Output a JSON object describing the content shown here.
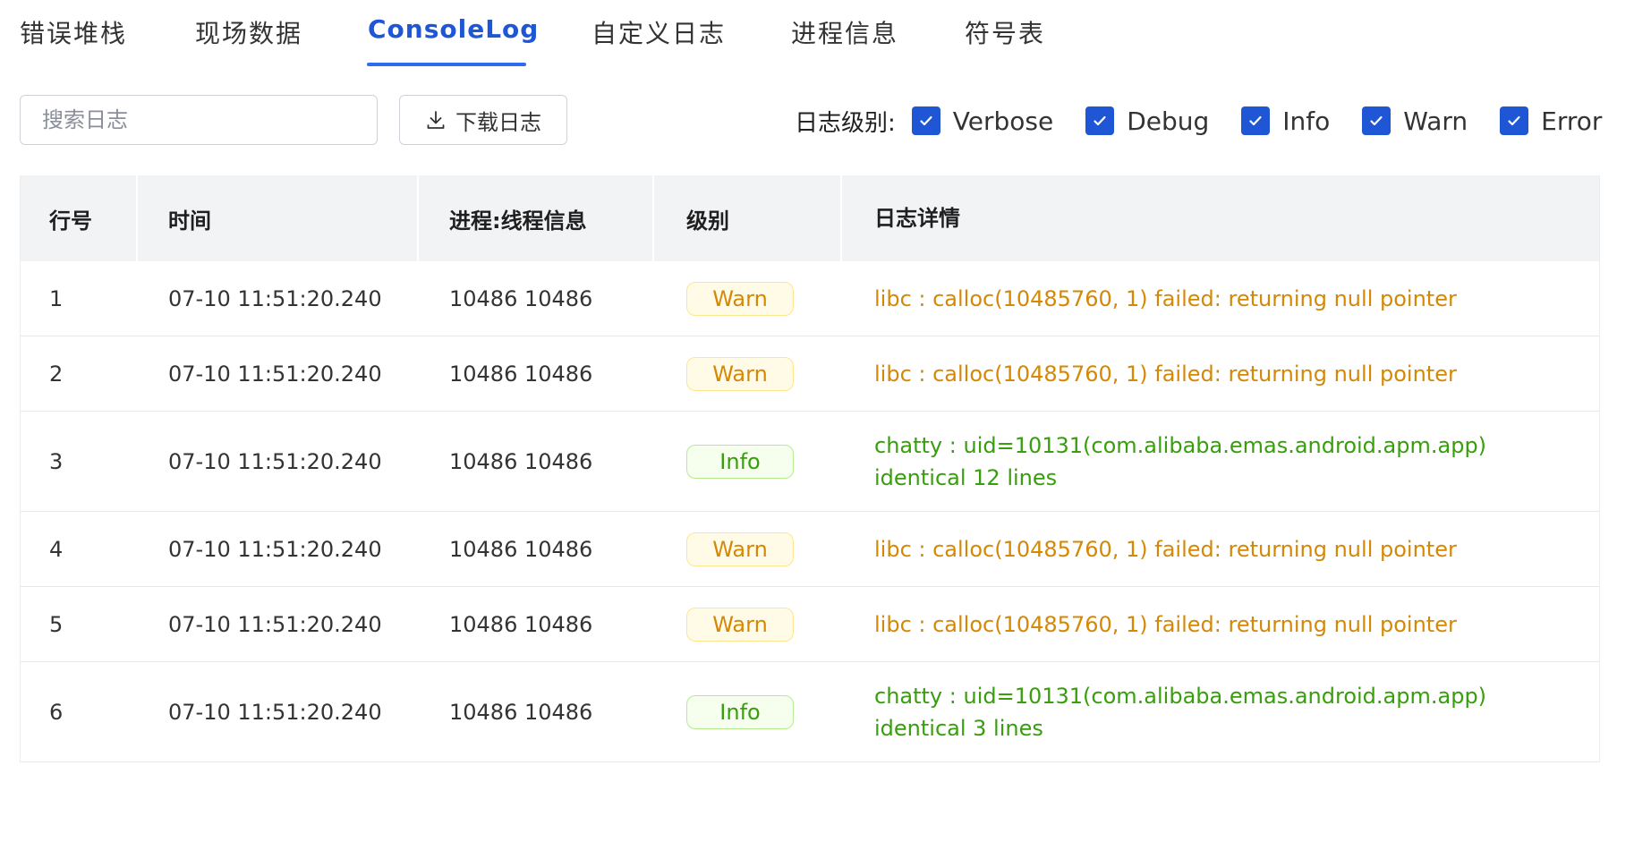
{
  "tabs": [
    {
      "label": "错误堆栈",
      "active": false
    },
    {
      "label": "现场数据",
      "active": false
    },
    {
      "label": "ConsoleLog",
      "active": true
    },
    {
      "label": "自定义日志",
      "active": false
    },
    {
      "label": "进程信息",
      "active": false
    },
    {
      "label": "符号表",
      "active": false
    }
  ],
  "toolbar": {
    "search_placeholder": "搜索日志",
    "download_label": "下载日志",
    "download_icon": "download-icon",
    "levels_label": "日志级别:",
    "levels": [
      {
        "label": "Verbose",
        "checked": true
      },
      {
        "label": "Debug",
        "checked": true
      },
      {
        "label": "Info",
        "checked": true
      },
      {
        "label": "Warn",
        "checked": true
      },
      {
        "label": "Error",
        "checked": true
      }
    ]
  },
  "table": {
    "headers": [
      "行号",
      "时间",
      "进程:线程信息",
      "级别",
      "日志详情"
    ],
    "rows": [
      {
        "line": "1",
        "time": "07-10 11:51:20.240",
        "pid": "10486 10486",
        "level": "Warn",
        "detail": "libc : calloc(10485760, 1) failed: returning null pointer"
      },
      {
        "line": "2",
        "time": "07-10 11:51:20.240",
        "pid": "10486 10486",
        "level": "Warn",
        "detail": "libc : calloc(10485760, 1) failed: returning null pointer"
      },
      {
        "line": "3",
        "time": "07-10 11:51:20.240",
        "pid": "10486 10486",
        "level": "Info",
        "detail": "chatty : uid=10131(com.alibaba.emas.android.apm.app) identical 12 lines"
      },
      {
        "line": "4",
        "time": "07-10 11:51:20.240",
        "pid": "10486 10486",
        "level": "Warn",
        "detail": "libc : calloc(10485760, 1) failed: returning null pointer"
      },
      {
        "line": "5",
        "time": "07-10 11:51:20.240",
        "pid": "10486 10486",
        "level": "Warn",
        "detail": "libc : calloc(10485760, 1) failed: returning null pointer"
      },
      {
        "line": "6",
        "time": "07-10 11:51:20.240",
        "pid": "10486 10486",
        "level": "Info",
        "detail": "chatty : uid=10131(com.alibaba.emas.android.apm.app) identical 3 lines"
      }
    ]
  },
  "colors": {
    "accent": "#1e56d6",
    "warn": "#d48806",
    "info": "#389e0d"
  }
}
